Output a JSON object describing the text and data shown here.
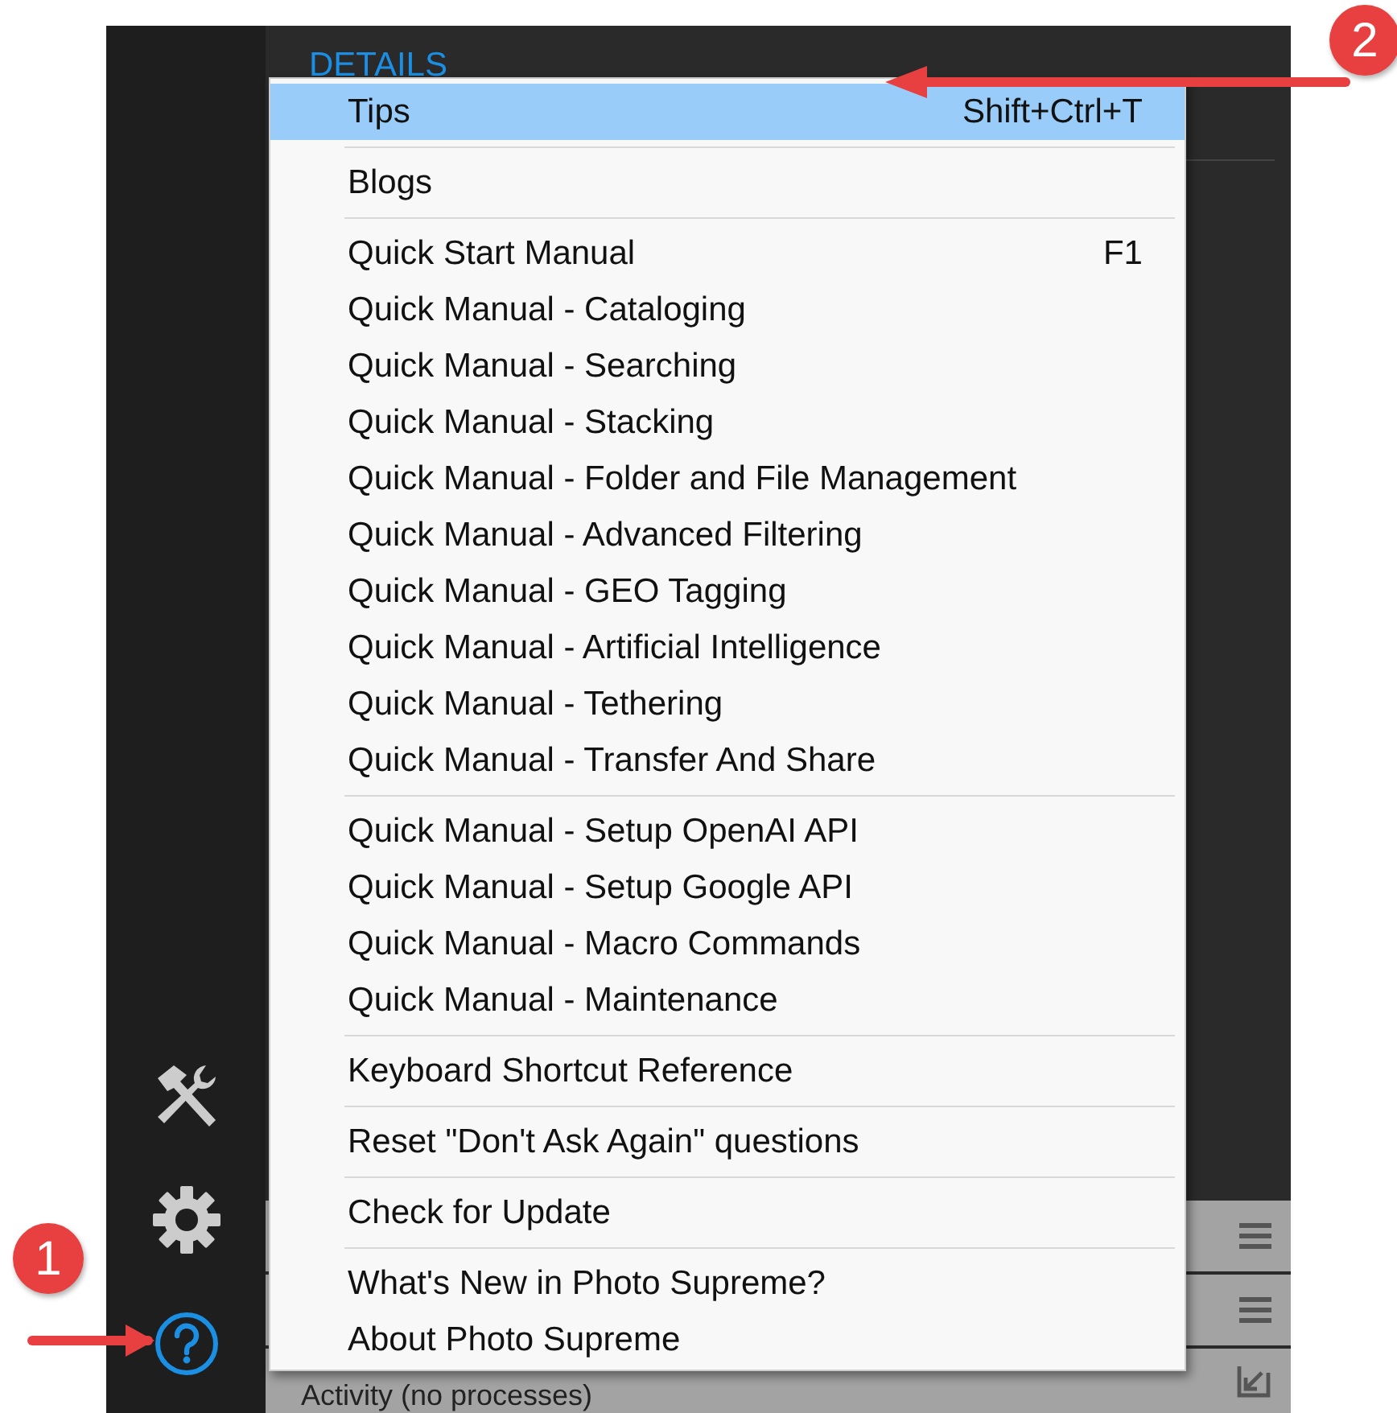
{
  "panel": {
    "title": "DETAILS"
  },
  "bottom_panels": [
    {
      "kind": "menu"
    },
    {
      "kind": "menu"
    },
    {
      "kind": "collapse",
      "label": "Activity (no processes)"
    }
  ],
  "sidebar": [
    {
      "selected": false
    },
    {
      "selected": false
    },
    {
      "selected": true
    }
  ],
  "menu": {
    "groups": [
      [
        {
          "label": "Tips",
          "shortcut": "Shift+Ctrl+T",
          "selected": true
        }
      ],
      [
        {
          "label": "Blogs",
          "selected": false
        }
      ],
      [
        {
          "label": "Quick Start Manual",
          "shortcut": "F1",
          "selected": false
        },
        {
          "label": "Quick Manual - Cataloging",
          "selected": false
        },
        {
          "label": "Quick Manual - Searching",
          "selected": false
        },
        {
          "label": "Quick Manual - Stacking",
          "selected": false
        },
        {
          "label": "Quick Manual - Folder and File Management",
          "selected": false
        },
        {
          "label": "Quick Manual - Advanced Filtering",
          "selected": false
        },
        {
          "label": "Quick Manual - GEO Tagging",
          "selected": false
        },
        {
          "label": "Quick Manual - Artificial Intelligence",
          "selected": false
        },
        {
          "label": "Quick Manual - Tethering",
          "selected": false
        },
        {
          "label": "Quick Manual - Transfer And Share",
          "selected": false
        }
      ],
      [
        {
          "label": "Quick Manual - Setup OpenAI API",
          "selected": false
        },
        {
          "label": "Quick Manual - Setup Google API",
          "selected": false
        },
        {
          "label": "Quick Manual - Macro Commands",
          "selected": false
        },
        {
          "label": "Quick Manual - Maintenance",
          "selected": false
        }
      ],
      [
        {
          "label": "Keyboard Shortcut Reference",
          "selected": false
        }
      ],
      [
        {
          "label": "Reset \"Don't Ask Again\" questions",
          "selected": false
        }
      ],
      [
        {
          "label": "Check for Update",
          "selected": false
        }
      ],
      [
        {
          "label": "What's New in Photo Supreme?",
          "selected": false
        },
        {
          "label": "About Photo Supreme",
          "selected": false
        }
      ]
    ]
  },
  "callouts": [
    {
      "number": "1"
    },
    {
      "number": "2"
    }
  ]
}
